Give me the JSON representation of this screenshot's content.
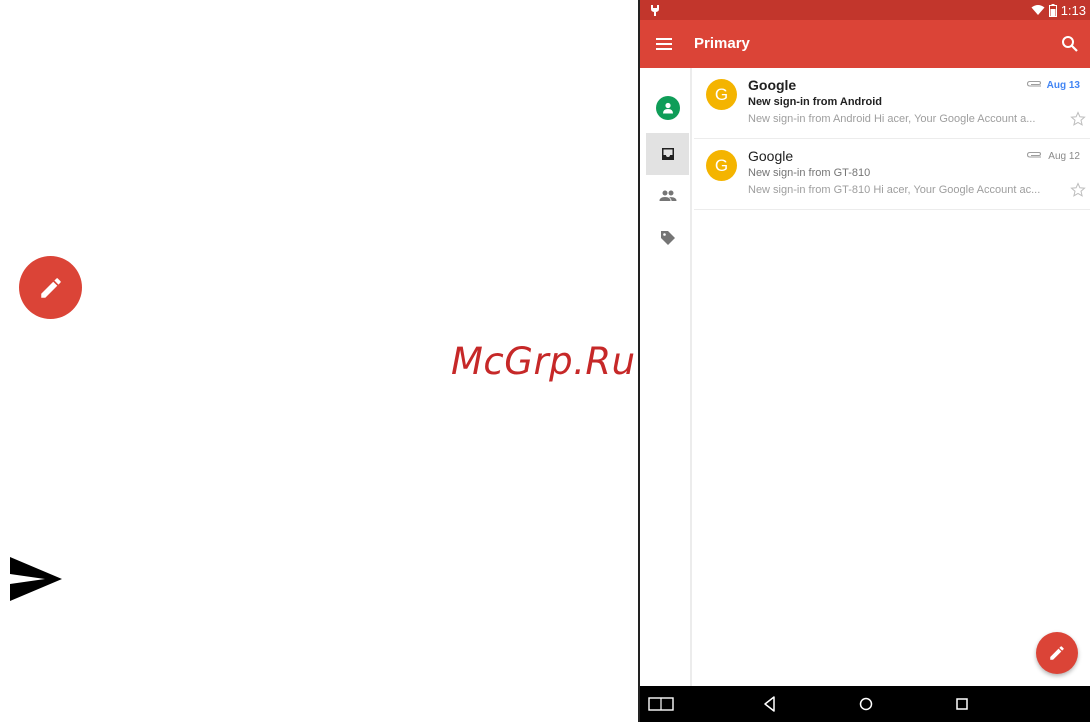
{
  "left": {
    "watermark": "McGrp.Ru"
  },
  "status_bar": {
    "time": "1:13"
  },
  "app_bar": {
    "title": "Primary"
  },
  "emails": [
    {
      "avatar_letter": "G",
      "sender": "Google",
      "subject": "New sign-in from Android",
      "snippet": "New sign-in from Android Hi acer, Your Google Account a...",
      "date": "Aug 13",
      "unread": true
    },
    {
      "avatar_letter": "G",
      "sender": "Google",
      "subject": "New sign-in from GT-810",
      "snippet": "New sign-in from GT-810 Hi acer, Your Google Account ac...",
      "date": "Aug 12",
      "unread": false
    }
  ],
  "colors": {
    "accent_red": "#db4437",
    "status_red": "#c2362c",
    "avatar_yellow": "#f4b400",
    "account_green": "#0f9d58",
    "unread_date_blue": "#4285f4"
  },
  "icons": {
    "rail": [
      "account-icon",
      "inbox-icon",
      "social-icon",
      "label-icon"
    ],
    "nav": [
      "recent-apps-icon",
      "back-icon",
      "home-icon",
      "overview-icon"
    ]
  }
}
